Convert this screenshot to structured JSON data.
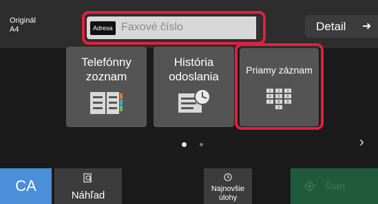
{
  "header": {
    "original_label": "Originál",
    "original_size": "A4",
    "address_tag": "Adresa",
    "fax_placeholder": "Faxové číslo",
    "detail_label": "Detail"
  },
  "tiles": [
    {
      "label": "Telefónny zoznam"
    },
    {
      "label": "História odoslania"
    },
    {
      "label": "Priamy záznam"
    }
  ],
  "keypad": [
    "1",
    "2",
    "3",
    "4",
    "5",
    "6",
    "7",
    "8",
    "9",
    "0"
  ],
  "pagination": {
    "pages": 2,
    "current": 1
  },
  "bottom": {
    "ca_label": "CA",
    "preview_label": "Náhľad",
    "recent_jobs_label": "Najnovšie úlohy",
    "start_label": "Štart"
  },
  "colors": {
    "highlight": "#e3203c",
    "ca_button": "#4a8fd8",
    "start_button": "#1f5a3d"
  }
}
